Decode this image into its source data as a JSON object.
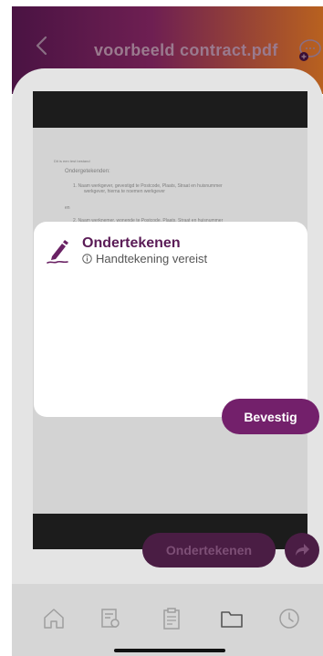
{
  "header": {
    "title": "voorbeeld contract.pdf",
    "back_icon": "chevron-left-icon",
    "chat_icon": "chat-add-icon"
  },
  "document": {
    "lines": [
      "Dit is een test bestand",
      "Ondergetekenden:",
      "1.   Naam werkgever, gevestigd te Postcode, Plaats, Straat en huisnummer",
      "werkgever, hierna te noemen werkgever",
      "en",
      "2.   Naam werknemer, wonende te Postcode, Plaats, Straat en huisnummer"
    ]
  },
  "modal": {
    "icon": "pen-sign-icon",
    "title": "Ondertekenen",
    "subtitle": "Handtekening vereist",
    "subtitle_icon": "info-icon",
    "confirm_label": "Bevestig"
  },
  "actions": {
    "sign_label": "Ondertekenen",
    "share_icon": "share-arrow-icon"
  },
  "nav": {
    "items": [
      {
        "icon": "home-icon"
      },
      {
        "icon": "document-search-icon"
      },
      {
        "icon": "clipboard-icon"
      },
      {
        "icon": "folder-icon"
      },
      {
        "icon": "clock-icon"
      }
    ]
  },
  "colors": {
    "brand": "#73206b",
    "header_gradient_start": "#4a1343",
    "header_gradient_end": "#b8611f",
    "modal_title": "#5a1b56"
  }
}
